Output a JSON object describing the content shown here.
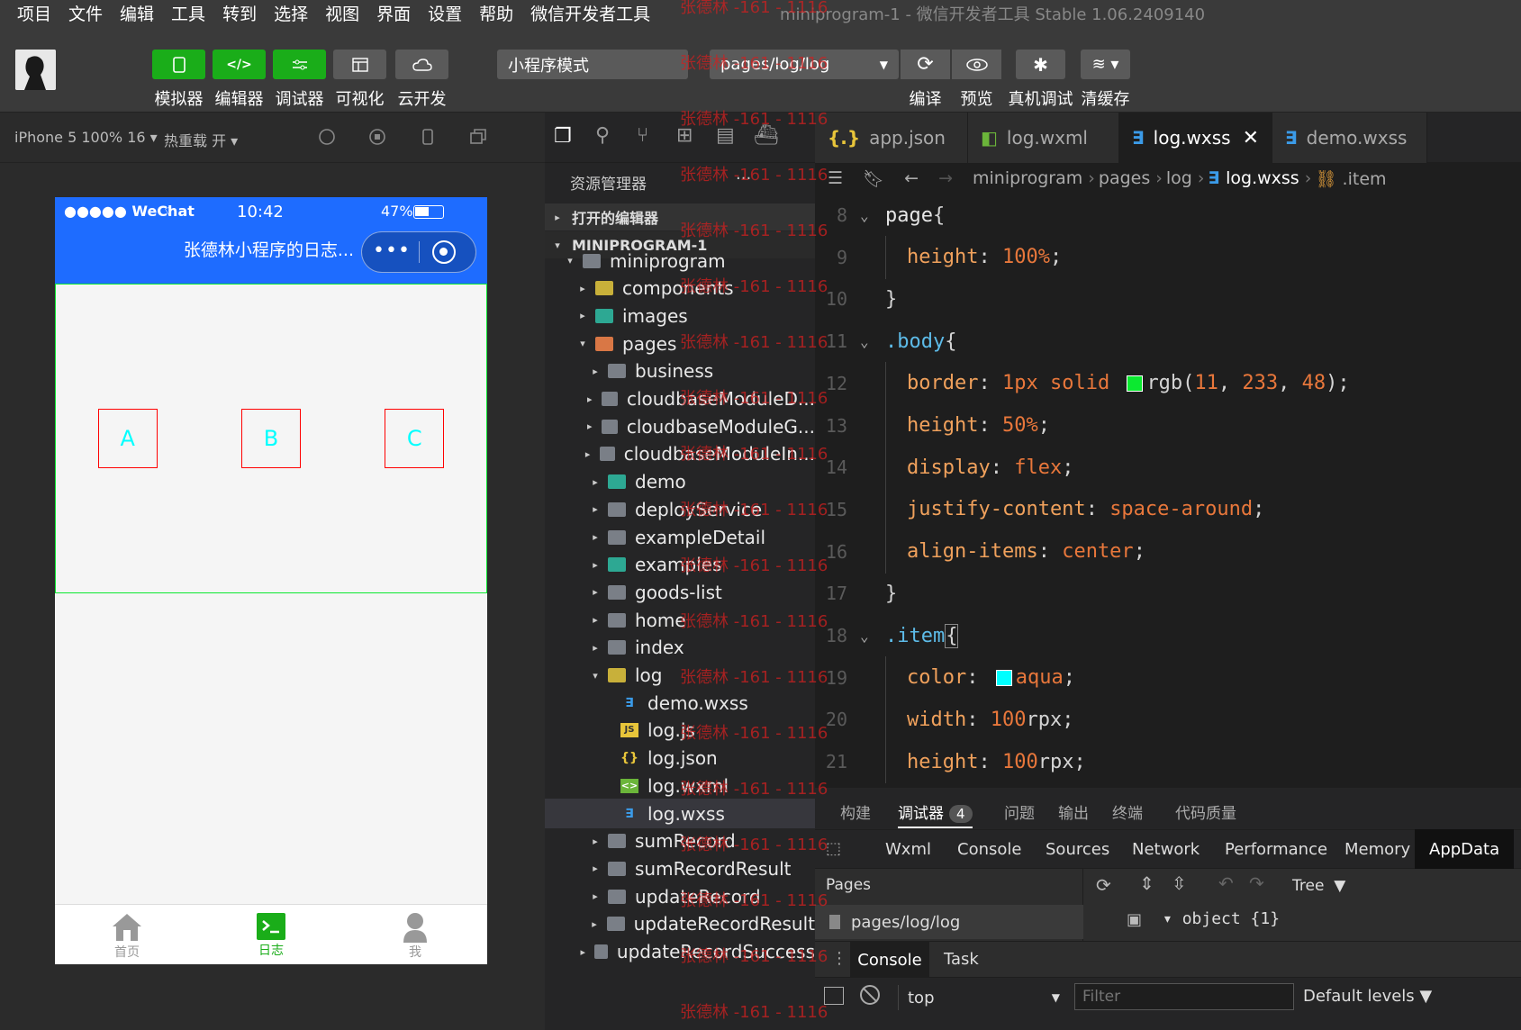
{
  "menu": [
    "项目",
    "文件",
    "编辑",
    "工具",
    "转到",
    "选择",
    "视图",
    "界面",
    "设置",
    "帮助",
    "微信开发者工具"
  ],
  "window_title": "miniprogram-1 - 微信开发者工具 Stable 1.06.2409140",
  "toolbar": {
    "simulator": "模拟器",
    "editor": "编辑器",
    "debugger": "调试器",
    "visual": "可视化",
    "cloud": "云开发",
    "mode_select": "小程序模式",
    "page_select": "pages/log/log",
    "compile": "编译",
    "preview": "预览",
    "real_debug": "真机调试",
    "clear_cache": "清缓存"
  },
  "device_bar": {
    "device": "iPhone 5 100% 16",
    "hot_reload": "热重载 开"
  },
  "phone": {
    "signal": "●●●●● WeChat",
    "time": "10:42",
    "battery": "47%",
    "title": "张德林小程序的日志...",
    "items": [
      "A",
      "B",
      "C"
    ],
    "tabs": [
      {
        "label": "首页"
      },
      {
        "label": "日志"
      },
      {
        "label": "我"
      }
    ]
  },
  "explorer": {
    "header": "资源管理器",
    "open_editors": "打开的编辑器",
    "project": "MINIPROGRAM-1",
    "tree": [
      {
        "name": "miniprogram",
        "depth": 0,
        "kind": "folder-open",
        "arrow": "▾",
        "color": ""
      },
      {
        "name": "components",
        "depth": 1,
        "kind": "folder",
        "arrow": "▸",
        "color": "g"
      },
      {
        "name": "images",
        "depth": 1,
        "kind": "folder",
        "arrow": "▸",
        "color": "t"
      },
      {
        "name": "pages",
        "depth": 1,
        "kind": "folder",
        "arrow": "▾",
        "color": "o"
      },
      {
        "name": "business",
        "depth": 2,
        "kind": "folder",
        "arrow": "▸",
        "color": ""
      },
      {
        "name": "cloudbaseModuleD...",
        "depth": 2,
        "kind": "folder",
        "arrow": "▸",
        "color": ""
      },
      {
        "name": "cloudbaseModuleG...",
        "depth": 2,
        "kind": "folder",
        "arrow": "▸",
        "color": ""
      },
      {
        "name": "cloudbaseModuleIn...",
        "depth": 2,
        "kind": "folder",
        "arrow": "▸",
        "color": ""
      },
      {
        "name": "demo",
        "depth": 2,
        "kind": "folder",
        "arrow": "▸",
        "color": "t"
      },
      {
        "name": "deployService",
        "depth": 2,
        "kind": "folder",
        "arrow": "▸",
        "color": ""
      },
      {
        "name": "exampleDetail",
        "depth": 2,
        "kind": "folder",
        "arrow": "▸",
        "color": ""
      },
      {
        "name": "examples",
        "depth": 2,
        "kind": "folder",
        "arrow": "▸",
        "color": "t"
      },
      {
        "name": "goods-list",
        "depth": 2,
        "kind": "folder",
        "arrow": "▸",
        "color": ""
      },
      {
        "name": "home",
        "depth": 2,
        "kind": "folder",
        "arrow": "▸",
        "color": ""
      },
      {
        "name": "index",
        "depth": 2,
        "kind": "folder",
        "arrow": "▸",
        "color": ""
      },
      {
        "name": "log",
        "depth": 2,
        "kind": "folder",
        "arrow": "▾",
        "color": "g"
      },
      {
        "name": "demo.wxss",
        "depth": 3,
        "kind": "wxss",
        "arrow": "",
        "color": ""
      },
      {
        "name": "log.js",
        "depth": 3,
        "kind": "js",
        "arrow": "",
        "color": ""
      },
      {
        "name": "log.json",
        "depth": 3,
        "kind": "json",
        "arrow": "",
        "color": ""
      },
      {
        "name": "log.wxml",
        "depth": 3,
        "kind": "wxml",
        "arrow": "",
        "color": ""
      },
      {
        "name": "log.wxss",
        "depth": 3,
        "kind": "wxss",
        "arrow": "",
        "color": "",
        "selected": true
      },
      {
        "name": "sumRecord",
        "depth": 2,
        "kind": "folder",
        "arrow": "▸",
        "color": ""
      },
      {
        "name": "sumRecordResult",
        "depth": 2,
        "kind": "folder",
        "arrow": "▸",
        "color": ""
      },
      {
        "name": "updateRecord",
        "depth": 2,
        "kind": "folder",
        "arrow": "▸",
        "color": ""
      },
      {
        "name": "updateRecordResult",
        "depth": 2,
        "kind": "folder",
        "arrow": "▸",
        "color": ""
      },
      {
        "name": "updateRecordSuccess",
        "depth": 2,
        "kind": "folder",
        "arrow": "▸",
        "color": ""
      }
    ]
  },
  "editor_tabs": [
    {
      "label": "app.json",
      "icon": "json",
      "active": false
    },
    {
      "label": "log.wxml",
      "icon": "wxml",
      "active": false
    },
    {
      "label": "log.wxss",
      "icon": "wxss",
      "active": true
    },
    {
      "label": "demo.wxss",
      "icon": "wxss",
      "active": false
    }
  ],
  "breadcrumb": [
    "miniprogram",
    "pages",
    "log",
    "log.wxss",
    ".item"
  ],
  "code_lines": [
    {
      "n": "8",
      "html": "<span class='sel-s'>page</span><span class='plain'>{</span>",
      "fold": true,
      "indent": 0
    },
    {
      "n": "9",
      "html": "<span class='prop'>height</span><span class='plain'>: </span><span class='val'>100%</span><span class='plain'>;</span>",
      "indent": 1
    },
    {
      "n": "10",
      "html": "<span class='plain'>}</span>",
      "indent": 0
    },
    {
      "n": "11",
      "html": "<span class='cls'>.body</span><span class='plain'>{</span>",
      "fold": true,
      "indent": 0
    },
    {
      "n": "12",
      "html": "<span class='prop'>border</span><span class='plain'>: </span><span class='val'>1px solid </span><span class='swatch' style='background:#0be930'></span><span class='plain'>rgb(</span><span class='val'>11</span><span class='plain'>, </span><span class='val'>233</span><span class='plain'>, </span><span class='val'>48</span><span class='plain'>);</span>",
      "indent": 1
    },
    {
      "n": "13",
      "html": "<span class='prop'>height</span><span class='plain'>: </span><span class='val'>50%</span><span class='plain'>;</span>",
      "indent": 1
    },
    {
      "n": "14",
      "html": "<span class='prop'>display</span><span class='plain'>: </span><span class='val'>flex</span><span class='plain'>;</span>",
      "indent": 1
    },
    {
      "n": "15",
      "html": "<span class='prop'>justify-content</span><span class='plain'>: </span><span class='val'>space-around</span><span class='plain'>;</span>",
      "indent": 1
    },
    {
      "n": "16",
      "html": "<span class='prop'>align-items</span><span class='plain'>: </span><span class='val'>center</span><span class='plain'>;</span>",
      "indent": 1
    },
    {
      "n": "17",
      "html": "<span class='plain'>}</span>",
      "indent": 0
    },
    {
      "n": "18",
      "html": "<span class='cls'>.item</span><span class='plain' style='border:1px solid #888'>{</span>",
      "fold": true,
      "indent": 0
    },
    {
      "n": "19",
      "html": "<span class='prop'>color</span><span class='plain'>: </span><span class='swatch' style='background:aqua'></span><span class='val'>aqua</span><span class='plain'>;</span>",
      "indent": 1
    },
    {
      "n": "20",
      "html": "<span class='prop'>width</span><span class='plain'>: </span><span class='val'>100</span><span class='plain'>rpx;</span>",
      "indent": 1
    },
    {
      "n": "21",
      "html": "<span class='prop'>height</span><span class='plain'>: </span><span class='val'>100</span><span class='plain'>rpx;</span>",
      "indent": 1
    }
  ],
  "panel_tabs": [
    {
      "label": "构建",
      "active": false
    },
    {
      "label": "调试器",
      "active": true,
      "badge": "4"
    },
    {
      "label": "问题",
      "active": false
    },
    {
      "label": "输出",
      "active": false
    },
    {
      "label": "终端",
      "active": false
    },
    {
      "label": "代码质量",
      "active": false
    }
  ],
  "devtools_tabs": [
    "Wxml",
    "Console",
    "Sources",
    "Network",
    "Performance",
    "Memory",
    "AppData"
  ],
  "appdata": {
    "pages_label": "Pages",
    "page_path": "pages/log/log",
    "tree_mode": "Tree",
    "object_label": "object {1}"
  },
  "console": {
    "tabs": [
      "Console",
      "Task"
    ],
    "context": "top",
    "filter_placeholder": "Filter",
    "levels": "Default levels"
  },
  "watermark": "张德林 -161 - 1116",
  "colors": {
    "accent": "#1aad19",
    "nav": "#1e6cff",
    "body_border": "#0be930",
    "item_text": "aqua"
  }
}
